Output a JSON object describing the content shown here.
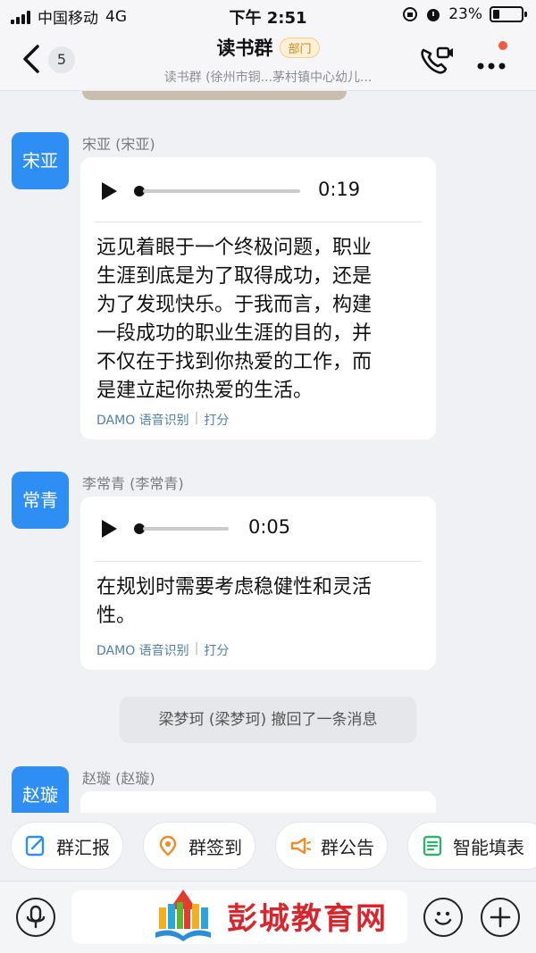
{
  "status_bar": {
    "carrier": "中国移动",
    "network": "4G",
    "time": "下午 2:51",
    "battery_percent": "23%",
    "battery_level": 0.23
  },
  "header": {
    "back_count": "5",
    "title": "读书群",
    "tag": "部门",
    "subtitle": "读书群 (徐州市铜...茅村镇中心幼儿..."
  },
  "messages": [
    {
      "avatar": "宋亚",
      "sender": "宋亚 (宋亚)",
      "duration": "0:19",
      "lines": [
        "远见着眼于一个终极问题，职业",
        "生涯到底是为了取得成功，还是",
        "为了发现快乐。于我而言，构建",
        "一段成功的职业生涯的目的，并",
        "不仅在于找到你热爱的工作，而",
        "是建立起你热爱的生活。"
      ],
      "asr": "DAMO 语音识别",
      "rate": "打分"
    },
    {
      "avatar": "常青",
      "sender": "李常青 (李常青)",
      "duration": "0:05",
      "lines": [
        "在规划时需要考虑稳健性和灵活",
        "性。"
      ],
      "asr": "DAMO 语音识别",
      "rate": "打分"
    }
  ],
  "recall_notice": "梁梦珂 (梁梦珂) 撤回了一条消息",
  "partial_message": {
    "avatar": "赵璇",
    "sender": "赵璇 (赵璇)"
  },
  "toolbar": {
    "items": [
      "群汇报",
      "群签到",
      "群公告",
      "智能填表"
    ]
  },
  "watermark": "彭城教育网",
  "colors": {
    "avatar": "#2f8ef4",
    "link": "#4f7fae",
    "watermark": "#d8262c"
  }
}
